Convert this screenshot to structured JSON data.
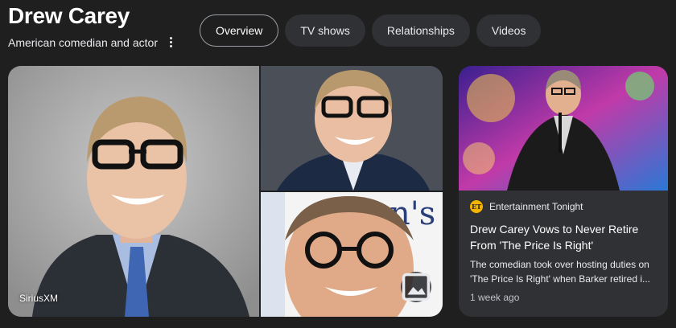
{
  "entity": {
    "name": "Drew Carey",
    "description": "American comedian and actor"
  },
  "tabs": [
    {
      "label": "Overview",
      "active": true
    },
    {
      "label": "TV shows",
      "active": false
    },
    {
      "label": "Relationships",
      "active": false
    },
    {
      "label": "Videos",
      "active": false
    }
  ],
  "gallery": {
    "main_credit": "SiriusXM",
    "images": [
      "portrait-photo",
      "headshot-photo",
      "closeup-photo"
    ]
  },
  "news": {
    "source": "Entertainment Tonight",
    "source_logo_text": "ET",
    "headline": "Drew Carey Vows to Never Retire From 'The Price Is Right'",
    "snippet_line1": "The comedian took over hosting duties on",
    "snippet_line2": "'The Price Is Right' when Barker retired i...",
    "time": "1 week ago"
  },
  "colors": {
    "background": "#1f1f1f",
    "tab_background": "#303134",
    "active_tab_border": "#9aa0a6",
    "card_background": "#303134",
    "et_logo": "#f5b400"
  }
}
